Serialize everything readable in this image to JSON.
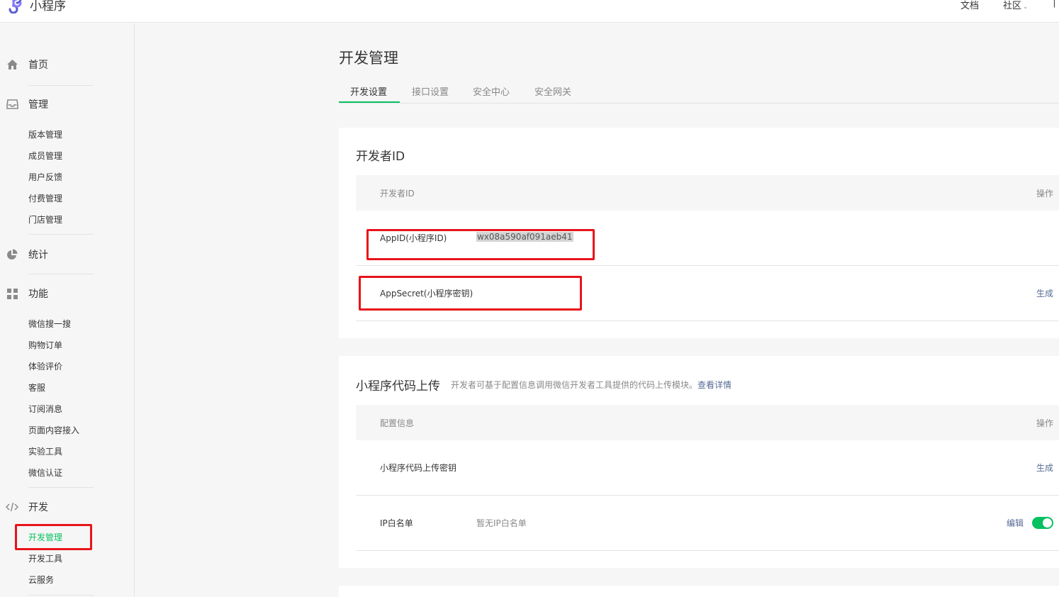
{
  "header": {
    "app_name": "小程序",
    "nav": {
      "docs": "文档",
      "community": "社区",
      "cut": "⎯"
    }
  },
  "sidebar": {
    "home": "首页",
    "manage": {
      "label": "管理",
      "items": [
        "版本管理",
        "成员管理",
        "用户反馈",
        "付费管理",
        "门店管理"
      ]
    },
    "stats": "统计",
    "features": {
      "label": "功能",
      "items": [
        "微信搜一搜",
        "购物订单",
        "体验评价",
        "客服",
        "订阅消息",
        "页面内容接入",
        "实验工具",
        "微信认证"
      ]
    },
    "dev": {
      "label": "开发",
      "items": [
        "开发管理",
        "开发工具",
        "云服务"
      ],
      "active": "开发管理"
    }
  },
  "main": {
    "title": "开发管理",
    "tabs": [
      "开发设置",
      "接口设置",
      "安全中心",
      "安全网关"
    ],
    "developer_id": {
      "title": "开发者ID",
      "header_left": "开发者ID",
      "header_right": "操作",
      "appid_label": "AppID(小程序ID)",
      "appid_value": "wx08a590af091aeb41",
      "secret_label": "AppSecret(小程序密钥)",
      "secret_action": "生成"
    },
    "code_upload": {
      "title": "小程序代码上传",
      "desc": "开发者可基于配置信息调用微信开发者工具提供的代码上传模块。",
      "desc_link": "查看详情",
      "header_left": "配置信息",
      "header_right": "操作",
      "key_label": "小程序代码上传密钥",
      "key_action": "生成",
      "ip_label": "IP白名单",
      "ip_value": "暂无IP白名单",
      "ip_action": "编辑",
      "ip_toggle_on": true
    }
  },
  "colors": {
    "accent_green": "#07c160",
    "link_blue": "#576b95",
    "highlight_red": "#e8141b"
  }
}
